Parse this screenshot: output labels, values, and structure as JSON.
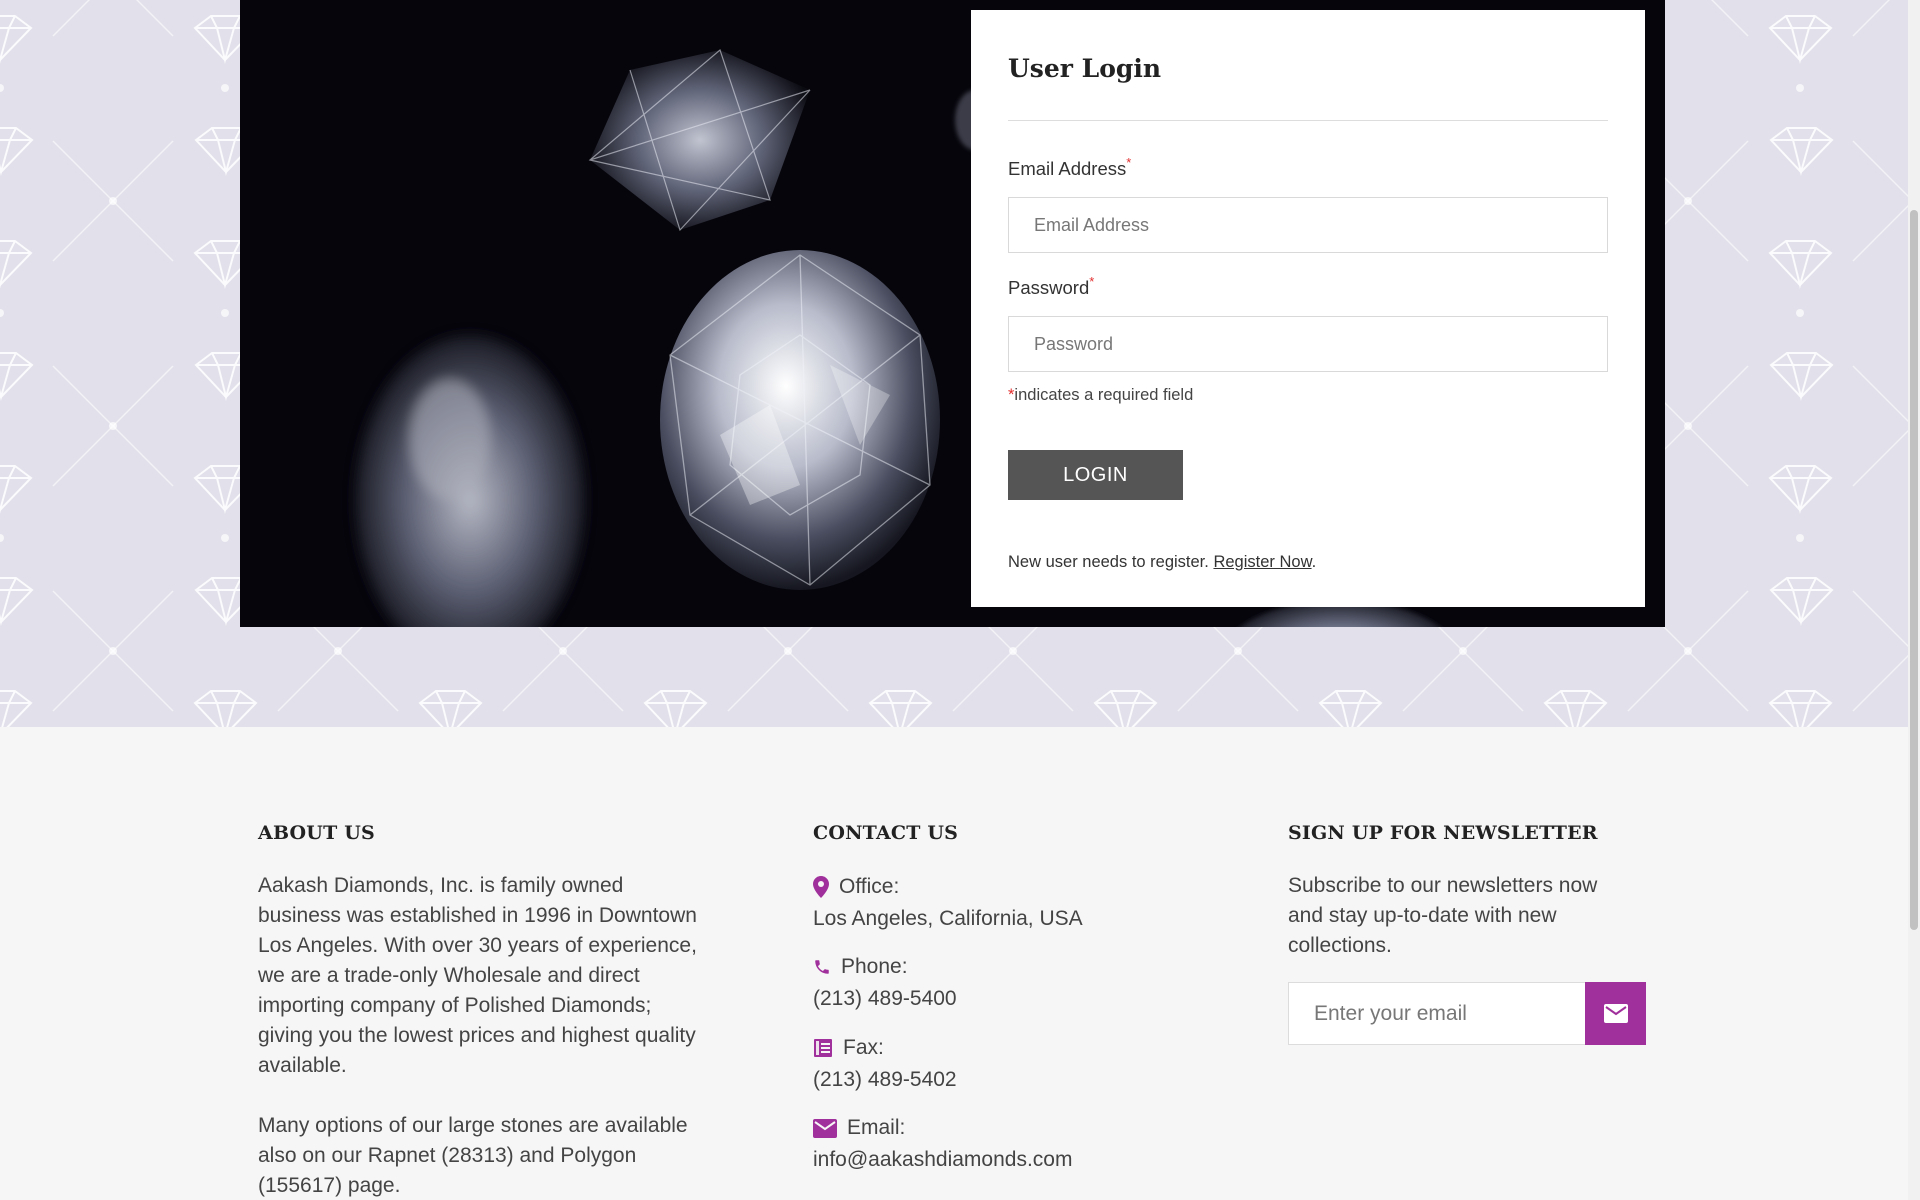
{
  "login": {
    "title": "User Login",
    "email_label": "Email Address",
    "email_placeholder": "Email Address",
    "email_value": "",
    "password_label": "Password",
    "password_placeholder": "Password",
    "password_value": "",
    "required_marker": "*",
    "required_note": "indicates a required field",
    "button_label": "LOGIN",
    "register_prefix": "New user needs to register.",
    "register_link": "Register Now",
    "register_suffix": "."
  },
  "footer": {
    "about": {
      "heading": "ABOUT US",
      "paragraph1": "Aakash Diamonds, Inc. is family owned business was established in 1996 in Downtown Los Angeles. With over 30 years of experience, we are a trade-only Wholesale and direct importing company of Polished Diamonds; giving you the lowest prices and highest quality available.",
      "paragraph2": "Many options of our large stones are available also on our Rapnet (28313) and Polygon (155617) page."
    },
    "contact": {
      "heading": "CONTACT US",
      "items": [
        {
          "icon": "map-pin-icon",
          "label": "Office:",
          "value": "Los Angeles, California, USA"
        },
        {
          "icon": "phone-icon",
          "label": "Phone:",
          "value": "(213) 489-5400"
        },
        {
          "icon": "fax-icon",
          "label": "Fax:",
          "value": "(213) 489-5402"
        },
        {
          "icon": "mail-icon",
          "label": "Email:",
          "value": "info@aakashdiamonds.com"
        }
      ]
    },
    "newsletter": {
      "heading": "SIGN UP FOR NEWSLETTER",
      "text": "Subscribe to our newsletters now and stay up-to-date with new collections.",
      "placeholder": "Enter your email",
      "value": "",
      "button_icon": "mail-icon"
    }
  },
  "colors": {
    "accent": "#a0309b",
    "button": "#555555",
    "pattern_bg": "#e2e0ea",
    "footer_bg": "#f6f6f6",
    "required": "#e32e2e"
  }
}
